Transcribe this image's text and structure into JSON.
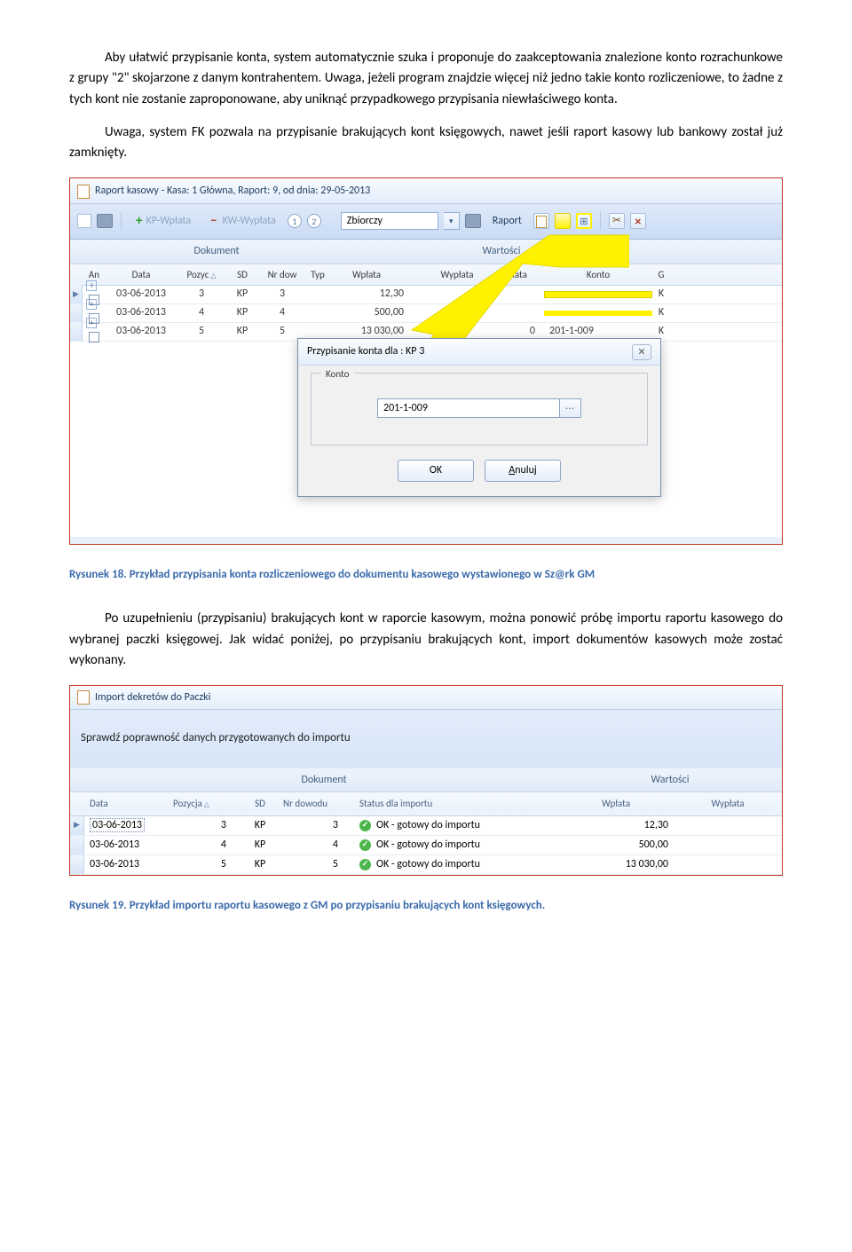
{
  "paragraphs": {
    "p1": "Aby ułatwić przypisanie konta, system automatycznie szuka i proponuje do zaakceptowania znalezione konto rozrachunkowe z grupy \"2\" skojarzone z danym kontrahentem. Uwaga, jeżeli program znajdzie więcej niż jedno takie konto rozliczeniowe, to żadne z tych kont nie zostanie zaproponowane, aby uniknąć przypadkowego przypisania niewłaściwego konta.",
    "p2": "Uwaga, system FK pozwala na przypisanie brakujących kont księgowych, nawet jeśli raport kasowy lub bankowy  został już zamknięty.",
    "p3": "Po uzupełnieniu (przypisaniu) brakujących kont w raporcie kasowym, można ponowić próbę importu raportu kasowego do wybranej paczki księgowej.  Jak widać poniżej, po przypisaniu brakujących kont, import dokumentów kasowych może zostać wykonany."
  },
  "captions": {
    "c1_prefix": "Rysunek 18.",
    "c1_text": "  Przykład przypisania konta rozliczeniowego do dokumentu kasowego wystawionego w Sz@rk GM",
    "c2_prefix": "Rysunek 19.",
    "c2_text": "  Przykład importu raportu kasowego z GM  po przypisaniu brakujących kont księgowych."
  },
  "s1": {
    "title": "Raport kasowy - Kasa: 1  Główna,  Raport: 9, od dnia: 29-05-2013",
    "toolbar": {
      "kp": "KP-Wpłata",
      "kw": "KW-Wypłata",
      "mode": "Zbiorczy",
      "raport": "Raport"
    },
    "group_headers": {
      "dok": "Dokument",
      "wart": "Wartości"
    },
    "columns": {
      "an": "An",
      "data": "Data",
      "poz": "Pozyc",
      "sd": "SD",
      "nr": "Nr dow",
      "typ": "Typ",
      "wpl": "Wpłata",
      "wyp": "Wypłata",
      "opl": "Opłata",
      "konto": "Konto",
      "g": "G"
    },
    "rows": [
      {
        "data": "03-06-2013",
        "poz": "3",
        "sd": "KP",
        "nr": "3",
        "wpl": "12,30",
        "wyp": "",
        "opl": "",
        "konto": "",
        "g": "K"
      },
      {
        "data": "03-06-2013",
        "poz": "4",
        "sd": "KP",
        "nr": "4",
        "wpl": "500,00",
        "wyp": "",
        "opl": "",
        "konto": "",
        "g": "K"
      },
      {
        "data": "03-06-2013",
        "poz": "5",
        "sd": "KP",
        "nr": "5",
        "wpl": "13 030,00",
        "wyp": "",
        "opl": "0",
        "konto": "201-1-009",
        "g": "K"
      }
    ],
    "dialog": {
      "title": "Przypisanie konta dla :  KP 3",
      "legend": "Konto",
      "value": "201-1-009",
      "ok": "OK",
      "cancel_u": "A",
      "cancel_rest": "nuluj"
    }
  },
  "s2": {
    "title": "Import dekretów do Paczki",
    "note": "Sprawdź poprawność danych przygotowanych do importu",
    "group_headers": {
      "dok": "Dokument",
      "wart": "Wartości"
    },
    "columns": {
      "data": "Data",
      "poz": "Pozycja",
      "sd": "SD",
      "nr": "Nr dowodu",
      "status": "Status dla importu",
      "wpl": "Wpłata",
      "wyp": "Wypłata"
    },
    "status_text": "OK - gotowy do importu",
    "rows": [
      {
        "data": "03-06-2013",
        "poz": "3",
        "sd": "KP",
        "nr": "3",
        "wpl": "12,30"
      },
      {
        "data": "03-06-2013",
        "poz": "4",
        "sd": "KP",
        "nr": "4",
        "wpl": "500,00"
      },
      {
        "data": "03-06-2013",
        "poz": "5",
        "sd": "KP",
        "nr": "5",
        "wpl": "13 030,00"
      }
    ]
  }
}
